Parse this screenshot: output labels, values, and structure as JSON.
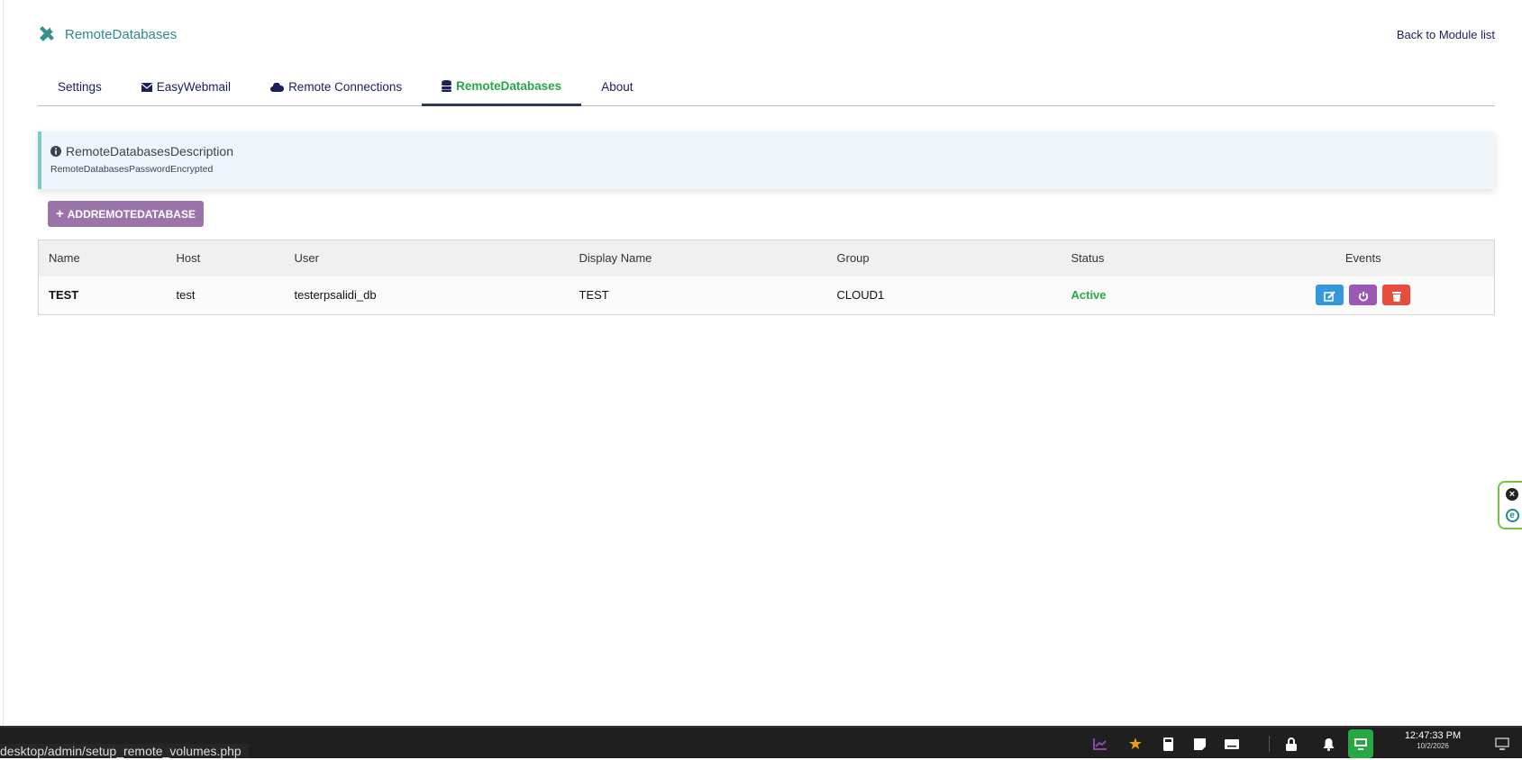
{
  "header": {
    "title": "RemoteDatabases",
    "back_link": "Back to Module list"
  },
  "tabs": [
    {
      "label": "Settings",
      "icon": ""
    },
    {
      "label": "EasyWebmail",
      "icon": "envelope-icon"
    },
    {
      "label": "Remote Connections",
      "icon": "cloud-icon"
    },
    {
      "label": "RemoteDatabases",
      "icon": "database-icon",
      "active": true
    },
    {
      "label": "About",
      "icon": ""
    }
  ],
  "info": {
    "title": "RemoteDatabasesDescription",
    "subtitle": "RemoteDatabasesPasswordEncrypted"
  },
  "add_button": "ADDREMOTEDATABASE",
  "table": {
    "headers": [
      "Name",
      "Host",
      "User",
      "Display Name",
      "Group",
      "Status",
      "Events"
    ],
    "rows": [
      {
        "name": "TEST",
        "host": "test",
        "user": "testerpsalidi_db",
        "display_name": "TEST",
        "group": "CLOUD1",
        "status": "Active"
      }
    ]
  },
  "statusbar": {
    "url": "desktop/admin/setup_remote_volumes.php"
  },
  "clock": {
    "time": "12:47:33 PM",
    "date": "10/2/2026"
  },
  "colors": {
    "accent": "#2e8a8a",
    "nav": "#1a1f5c",
    "add": "#9b74aa",
    "edit": "#3498db",
    "power": "#9b59b6",
    "delete": "#e74c3c",
    "active": "#28a745"
  }
}
